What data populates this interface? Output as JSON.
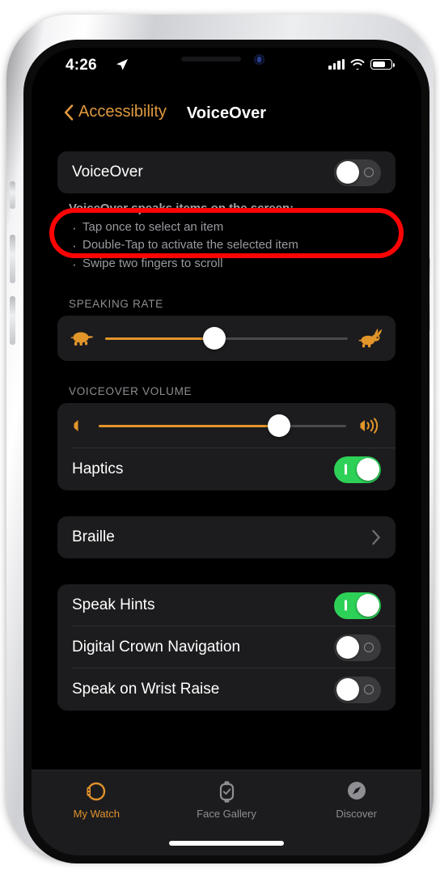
{
  "status_bar": {
    "time": "4:26",
    "location_icon": "location-arrow-icon",
    "signal_icon": "cellular-signal-icon",
    "wifi_icon": "wifi-icon",
    "battery_icon": "battery-icon",
    "battery_level_pct": 62
  },
  "nav": {
    "back_label": "Accessibility",
    "back_icon": "chevron-left-icon",
    "title": "VoiceOver"
  },
  "voiceover": {
    "label": "VoiceOver",
    "enabled": false,
    "highlighted": true,
    "highlight_color": "#fb0404",
    "description_title": "VoiceOver speaks items on the screen:",
    "description_items": [
      "Tap once to select an item",
      "Double-Tap to activate the selected item",
      "Swipe two fingers to scroll"
    ]
  },
  "speaking_rate": {
    "header": "SPEAKING RATE",
    "min_icon": "turtle-icon",
    "max_icon": "rabbit-icon",
    "value_pct": 45
  },
  "voiceover_volume": {
    "header": "VOICEOVER VOLUME",
    "min_icon": "speaker-low-icon",
    "max_icon": "speaker-high-icon",
    "value_pct": 73,
    "haptics": {
      "label": "Haptics",
      "enabled": true
    }
  },
  "braille": {
    "label": "Braille",
    "chevron_icon": "chevron-right-icon"
  },
  "settings_rows": [
    {
      "label": "Speak Hints",
      "enabled": true
    },
    {
      "label": "Digital Crown Navigation",
      "enabled": false
    },
    {
      "label": "Speak on Wrist Raise",
      "enabled": false
    }
  ],
  "tab_bar": {
    "tabs": [
      {
        "label": "My Watch",
        "icon": "watch-icon",
        "active": true
      },
      {
        "label": "Face Gallery",
        "icon": "watch-face-icon",
        "active": false
      },
      {
        "label": "Discover",
        "icon": "compass-icon",
        "active": false
      }
    ],
    "active_color": "#e0912c",
    "inactive_color": "#8e8e93"
  },
  "colors": {
    "accent_orange": "#e09a3e",
    "toggle_on_green": "#2ed158",
    "card_background": "#1c1c1e",
    "page_background": "#000000"
  }
}
